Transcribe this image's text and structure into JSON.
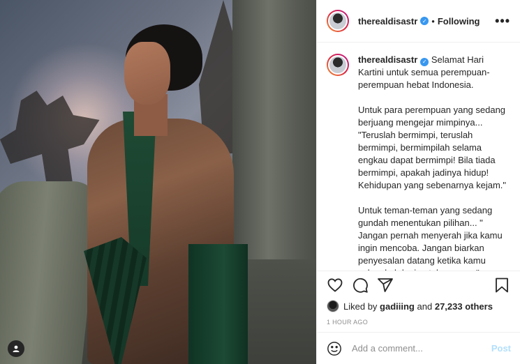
{
  "post": {
    "username": "therealdisastr",
    "follow_status": "Following",
    "more_label": "•••",
    "caption_username": "therealdisastr",
    "caption_paragraphs": [
      "Selamat Hari Kartini untuk semua perempuan-perempuan hebat Indonesia.",
      "Untuk para perempuan yang sedang berjuang mengejar mimpinya... \"Teruslah bermimpi, teruslah bermimpi, bermimpilah selama engkau dapat bermimpi! Bila tiada bermimpi, apakah jadinya hidup! Kehidupan yang sebenarnya kejam.\"",
      "Untuk teman-teman yang sedang gundah menentukan pilihan... \" Jangan pernah menyerah jika kamu ingin mencoba. Jangan biarkan penyesalan datang ketika kamu selangkah lagi untuk menang\""
    ],
    "likes": {
      "prefix": "Liked by",
      "user": "gadiiing",
      "conjunction": "and",
      "count": "27,233 others"
    },
    "timestamp": "1 HOUR AGO"
  },
  "comment": {
    "placeholder": "Add a comment...",
    "post_label": "Post"
  },
  "icons": {
    "like": "heart-icon",
    "comment": "comment-icon",
    "share": "share-icon",
    "save": "bookmark-icon",
    "emoji": "emoji-icon",
    "tag": "user-tag-icon"
  },
  "colors": {
    "verified": "#3897f0",
    "post_button": "#b2dffc",
    "timestamp": "#8e8e8e"
  }
}
